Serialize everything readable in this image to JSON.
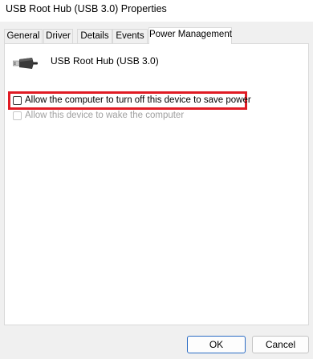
{
  "window": {
    "title": "USB Root Hub (USB 3.0) Properties"
  },
  "tabs": [
    {
      "label": "General"
    },
    {
      "label": "Driver"
    },
    {
      "label": "Details"
    },
    {
      "label": "Events"
    },
    {
      "label": "Power Management",
      "active": true
    }
  ],
  "device": {
    "name": "USB Root Hub (USB 3.0)",
    "icon": "usb-plug-icon"
  },
  "options": {
    "allow_turn_off": {
      "label": "Allow the computer to turn off this device to save power",
      "checked": false,
      "enabled": true
    },
    "allow_wake": {
      "label": "Allow this device to wake the computer",
      "checked": false,
      "enabled": false
    }
  },
  "annotation": {
    "highlight_color": "#e01b24"
  },
  "buttons": {
    "ok": "OK",
    "cancel": "Cancel"
  }
}
